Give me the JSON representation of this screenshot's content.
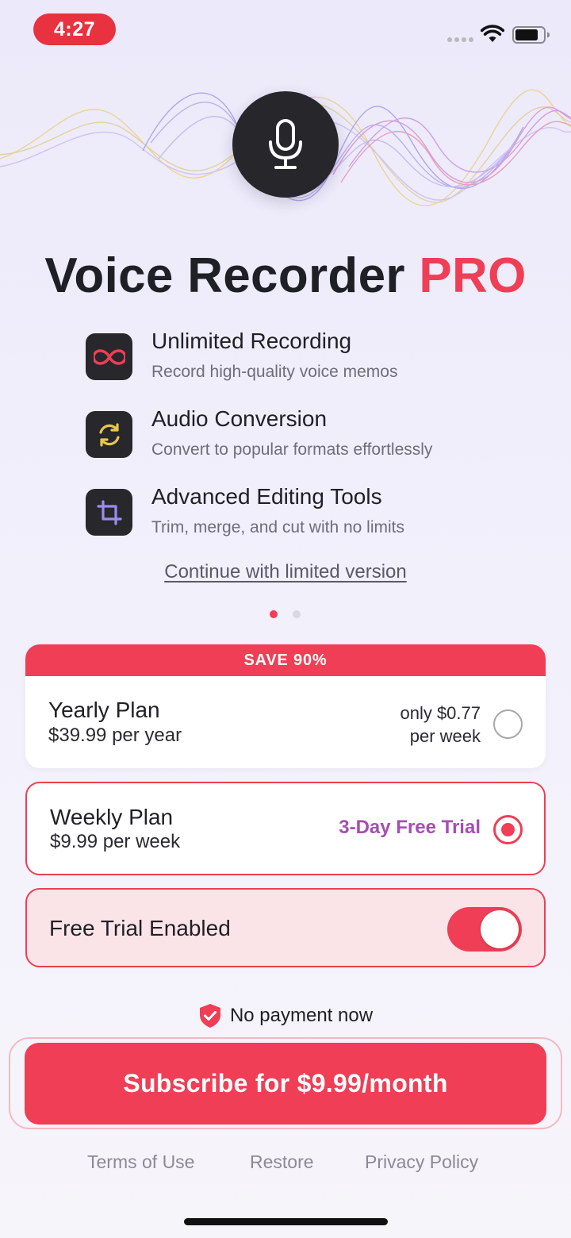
{
  "status_bar": {
    "time": "4:27"
  },
  "hero": {
    "title_main": "Voice Recorder",
    "title_accent": "PRO",
    "icon": "microphone-icon"
  },
  "features": [
    {
      "icon": "infinity-icon",
      "title": "Unlimited Recording",
      "subtitle": "Record high-quality voice memos"
    },
    {
      "icon": "refresh-icon",
      "title": "Audio Conversion",
      "subtitle": "Convert to popular formats effortlessly"
    },
    {
      "icon": "crop-icon",
      "title": "Advanced Editing Tools",
      "subtitle": "Trim, merge, and cut with no limits"
    }
  ],
  "limited_link": "Continue with limited version",
  "plans": {
    "yearly": {
      "banner": "SAVE 90%",
      "name": "Yearly Plan",
      "price": "$39.99 per year",
      "per_week_line1": "only $0.77",
      "per_week_line2": "per week",
      "selected": false
    },
    "weekly": {
      "name": "Weekly Plan",
      "price": "$9.99 per week",
      "trial": "3-Day Free Trial",
      "selected": true
    }
  },
  "free_trial": {
    "label": "Free Trial Enabled",
    "enabled": true
  },
  "no_payment": "No payment now",
  "subscribe": {
    "label": "Subscribe for $9.99/month"
  },
  "footer": {
    "terms": "Terms of Use",
    "restore": "Restore",
    "privacy": "Privacy Policy"
  },
  "colors": {
    "accent": "#ef3e55",
    "trial_purple": "#a54fb2",
    "dark_icon_bg": "#27272c"
  }
}
